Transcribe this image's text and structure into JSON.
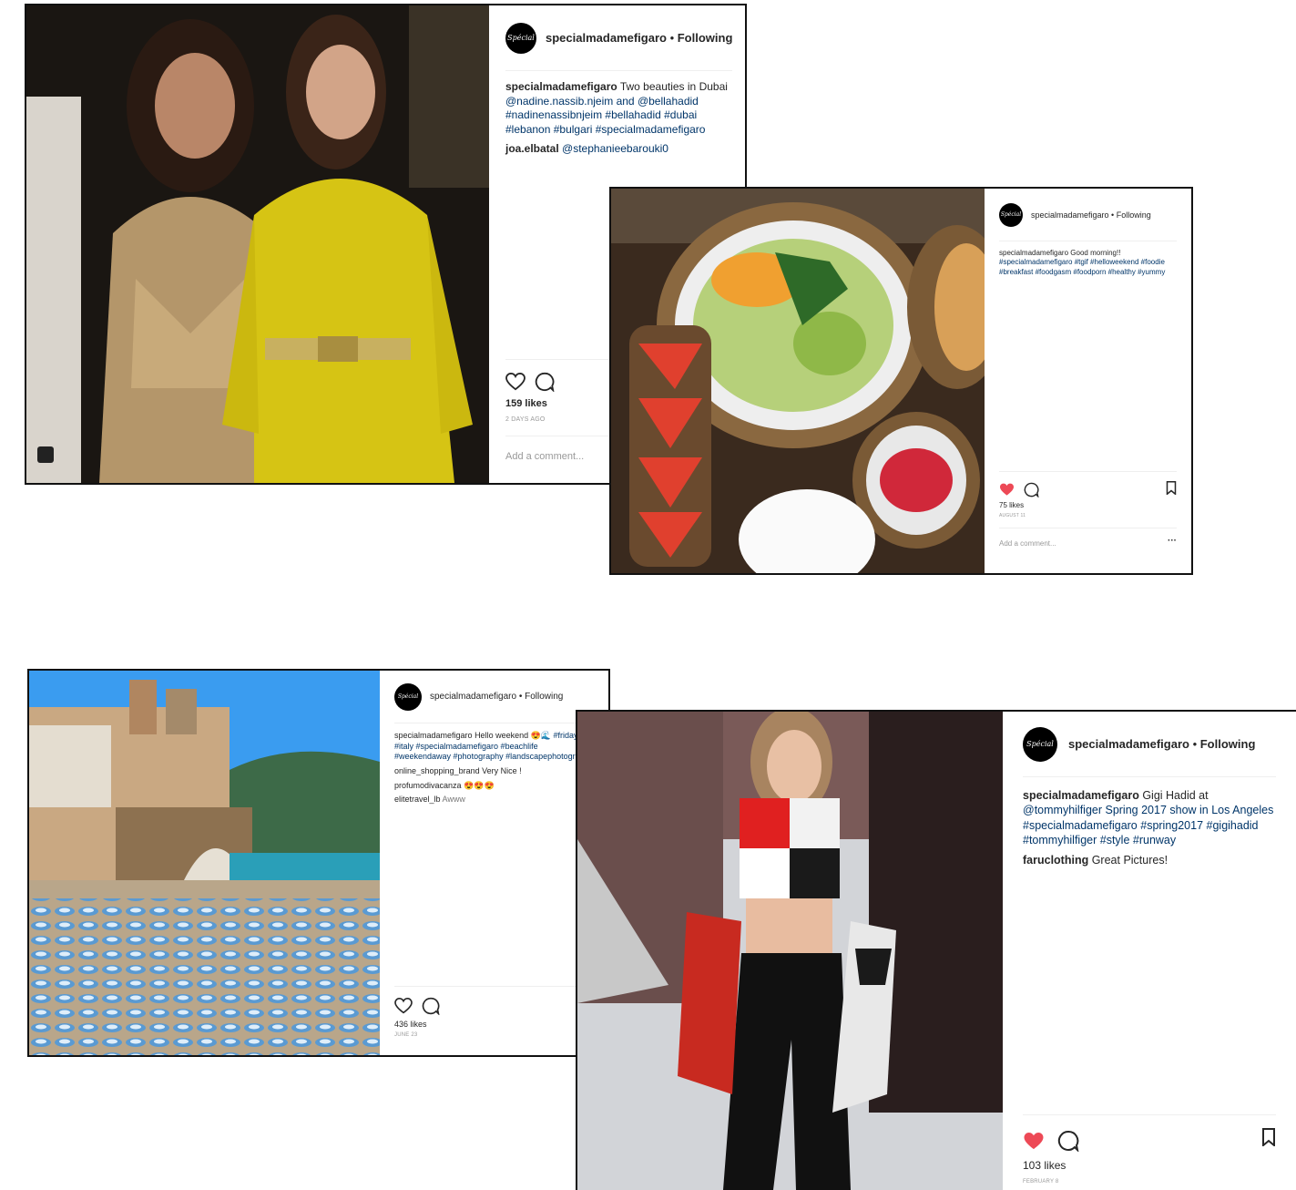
{
  "colors": {
    "tag": "#003569",
    "liked": "#ed4956",
    "border": "#111111"
  },
  "posts": [
    {
      "username": "specialmadamefigaro",
      "avatar_text": "Spécial",
      "follow_label": "Following",
      "caption": {
        "user": "specialmadamefigaro",
        "text": "Two beauties in Dubai",
        "tags": "@nadine.nassib.njeim and @bellahadid #nadinenassibnjeim #bellahadid #dubai #lebanon #bulgari #specialmadamefigaro"
      },
      "comments": [
        {
          "user": "joa.elbatal",
          "text": "@stephanieebarouki0"
        }
      ],
      "liked": false,
      "likes": "159 likes",
      "time": "2 DAYS AGO",
      "add_comment_placeholder": "Add a comment..."
    },
    {
      "username": "specialmadamefigaro",
      "avatar_text": "Spécial",
      "follow_label": "Following",
      "caption": {
        "user": "specialmadamefigaro",
        "text": "Good morning!!",
        "tags": "#specialmadamefigaro #tgif #helloweekend #foodie #breakfast #foodgasm #foodporn #healthy #yummy"
      },
      "comments": [],
      "liked": true,
      "likes": "75 likes",
      "time": "AUGUST 11",
      "add_comment_placeholder": "Add a comment...",
      "more_label": "···"
    },
    {
      "username": "specialmadamefigaro",
      "avatar_text": "Spécial",
      "follow_label": "Following",
      "caption": {
        "user": "specialmadamefigaro",
        "text": "Hello weekend 😍🌊",
        "tags": "#friday #italy #specialmadamefigaro #beachlife #weekendaway #photography #landscapephotography"
      },
      "comments": [
        {
          "user": "online_shopping_brand",
          "text": "Very Nice !"
        },
        {
          "user": "profumodivacanza",
          "text": "😍😍😍"
        },
        {
          "user": "elitetravel_lb",
          "text": "Awww"
        }
      ],
      "liked": false,
      "likes": "436 likes",
      "time": "JUNE 23"
    },
    {
      "username": "specialmadamefigaro",
      "avatar_text": "Spécial",
      "follow_label": "Following",
      "caption": {
        "user": "specialmadamefigaro",
        "text": "Gigi Hadid at",
        "tags": "@tommyhilfiger Spring 2017 show in Los Angeles #specialmadamefigaro #spring2017 #gigihadid #tommyhilfiger #style #runway"
      },
      "comments": [
        {
          "user": "faruclothing",
          "text": "Great Pictures!"
        }
      ],
      "liked": true,
      "likes": "103 likes",
      "time": "FEBRUARY 8"
    }
  ]
}
